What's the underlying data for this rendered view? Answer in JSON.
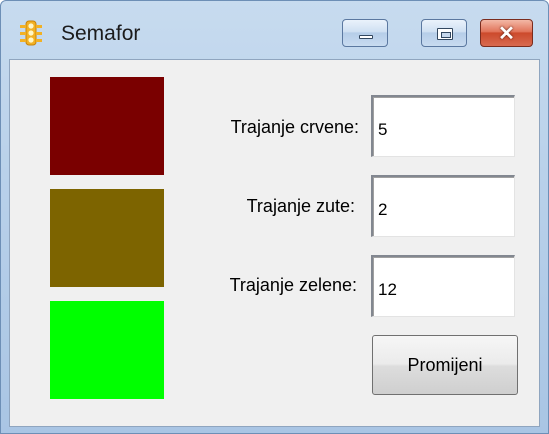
{
  "window": {
    "title": "Semafor"
  },
  "lights": {
    "red_color": "#7a0000",
    "yellow_color": "#7d6400",
    "green_color": "#00ff00"
  },
  "form": {
    "red_label": "Trajanje crvene:",
    "red_value": "5",
    "yellow_label": "Trajanje zute:",
    "yellow_value": "2",
    "green_label": "Trajanje zelene:",
    "green_value": "12",
    "apply_button": "Promijeni"
  },
  "icons": {
    "app": "traffic-light-icon",
    "minimize": "minimize-icon",
    "maximize": "maximize-icon",
    "close": "close-icon"
  }
}
